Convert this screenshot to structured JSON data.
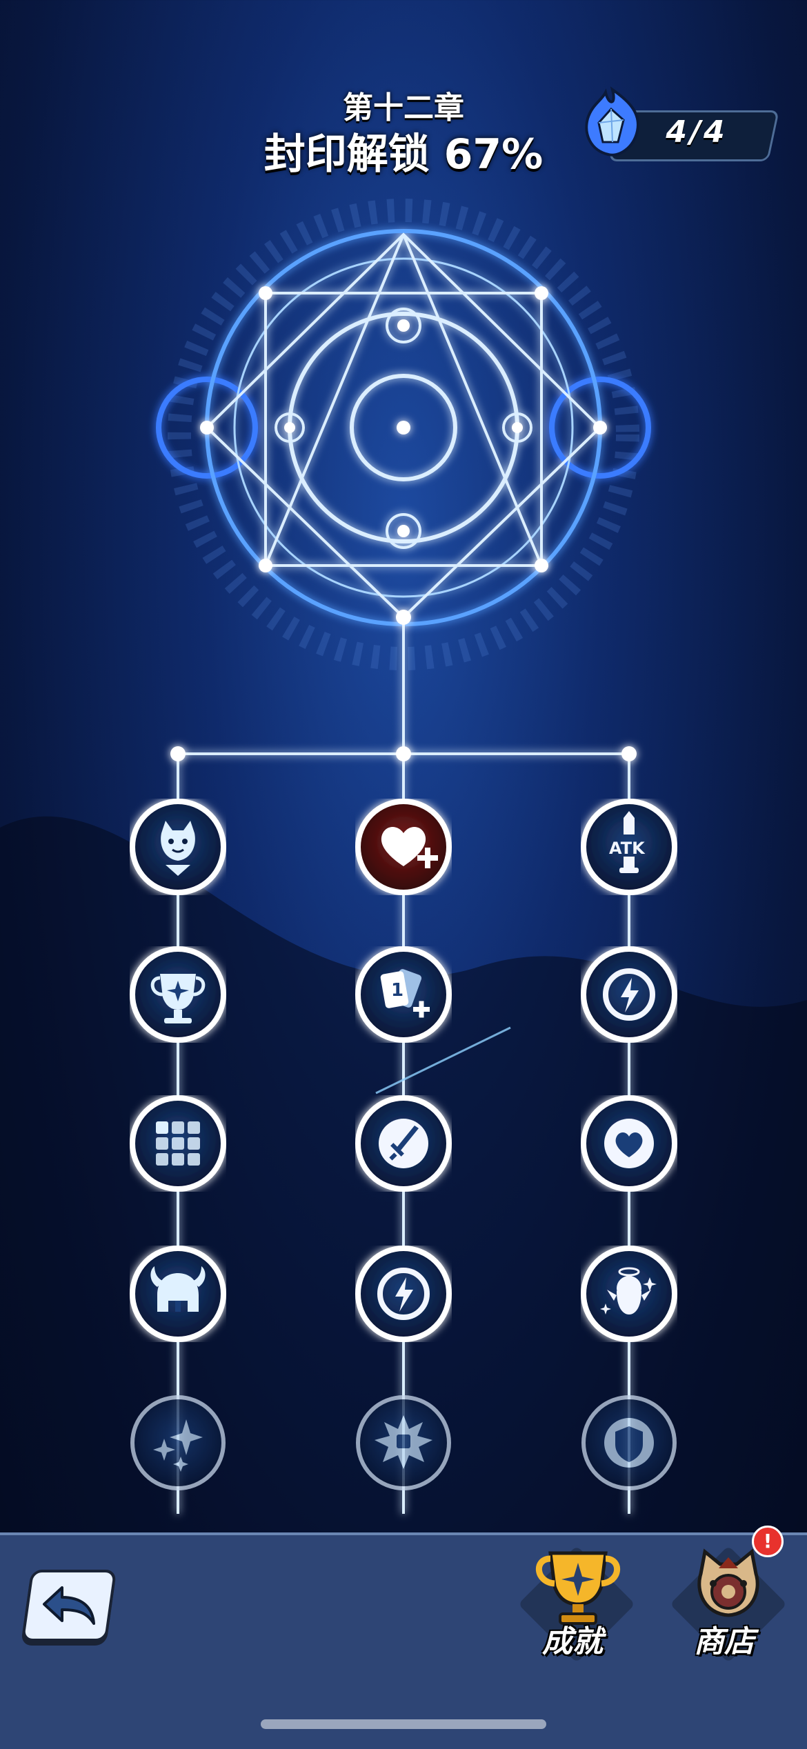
{
  "header": {
    "chapter_title": "第十二章",
    "unlock_label": "封印解锁 67%"
  },
  "currency": {
    "icon": "blue-flame-crystal-icon",
    "value": "4/4"
  },
  "skill_tree": {
    "columns": [
      {
        "nodes": [
          "cat-face-icon",
          "trophy-icon",
          "grid-icon",
          "viking-helmet-icon",
          "sparkle-icon"
        ]
      },
      {
        "nodes": [
          "heart-plus-icon",
          "card-plus-icon",
          "sword-icon",
          "lightning-icon",
          "starburst-icon"
        ]
      },
      {
        "nodes": [
          "atk-sword-icon",
          "lightning-icon",
          "heart-icon",
          "angel-ghost-icon",
          "shield-icon"
        ]
      }
    ]
  },
  "bottom_nav": {
    "back_icon": "back-arrow-icon",
    "achievements_label": "成就",
    "shop_label": "商店",
    "shop_badge": "!"
  },
  "colors": {
    "background": "#0f2a6b",
    "glow": "#7fc4ff",
    "bottom_bar": "#2e4575",
    "badge": "#e8322d"
  }
}
